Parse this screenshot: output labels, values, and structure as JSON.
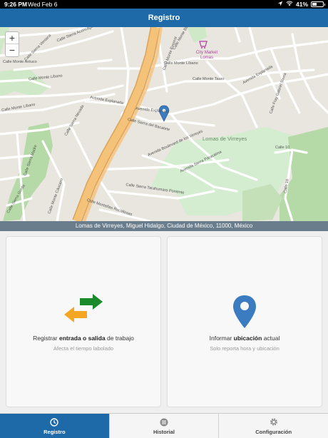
{
  "status_bar": {
    "time": "9:26 PM",
    "date": "Wed Feb 6",
    "battery": "41%"
  },
  "nav": {
    "title": "Registro"
  },
  "map": {
    "zoom_in": "+",
    "zoom_out": "−",
    "streets": [
      "Calle Sierra Aconcagua",
      "Calle Sierra Ventana",
      "Calle Monte Antuco",
      "Calle Monte Líbano",
      "Calle Monte Blanco",
      "Calle Monte Líbano",
      "Calle Monte Tauro",
      "Calle Monte Everest",
      "Avenida Explanada",
      "Avenida Explanada",
      "Avenida Explanada",
      "Calle Sierra del Bacatete",
      "Avenida Boulevard de los Virreyes",
      "Calle Monte Cáucaso",
      "Calle Sierra Tarahumara Poniente",
      "Calle Montañas Rocallosas",
      "Calle Sierra Madre",
      "Calle Sierra Gorda",
      "Calle Monte Líbano",
      "Calle Sierra Nevada",
      "Calle 10",
      "Calle 16",
      "Calle Fray Gabriel Sierra",
      "Avenida Sierra Paracaima"
    ],
    "place": "Lomas de Virreyes",
    "poi": "City Market Lomas"
  },
  "address": "Lomas de Virreyes, Miguel Hidalgo, Ciudad de México, 11000, México",
  "cards": {
    "work": {
      "prefix": "Registrar ",
      "bold": "entrada o salida",
      "suffix": " de trabajo",
      "subtitle": "Afecta el tiempo labolado"
    },
    "location": {
      "prefix": "Informar ",
      "bold": "ubicación",
      "suffix": " actual",
      "subtitle": "Solo reporta hora y ubicación"
    }
  },
  "tabs": [
    {
      "label": "Registro",
      "icon": "clock-icon"
    },
    {
      "label": "Historial",
      "icon": "list-icon"
    },
    {
      "label": "Configuración",
      "icon": "gear-icon"
    }
  ],
  "colors": {
    "primary": "#1e6aa8",
    "arrow_green": "#1a8a2a",
    "arrow_orange": "#f5a623",
    "pin": "#3b7bbf"
  }
}
